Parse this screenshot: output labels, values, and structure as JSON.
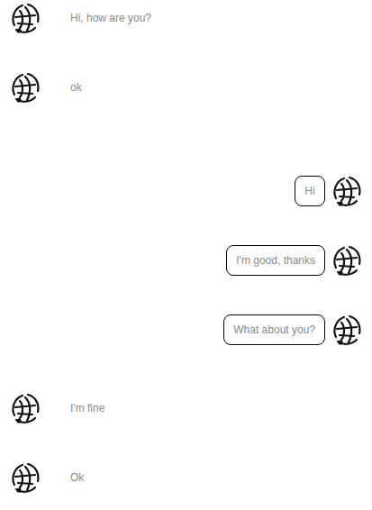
{
  "messages": [
    {
      "kind": "incoming",
      "text": "Hi, how are you?"
    },
    {
      "kind": "incoming",
      "text": "ok"
    },
    {
      "kind": "outgoing",
      "text": "Hi"
    },
    {
      "kind": "outgoing",
      "text": "I'm good, thanks"
    },
    {
      "kind": "outgoing",
      "text": "What about you?"
    },
    {
      "kind": "incoming",
      "text": "I'm fine"
    },
    {
      "kind": "incoming",
      "text": "Ok"
    }
  ]
}
